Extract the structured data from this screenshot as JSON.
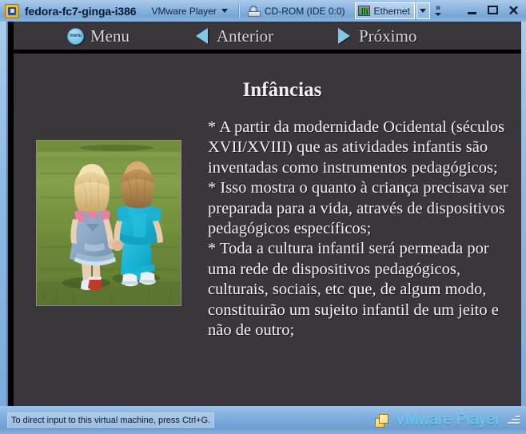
{
  "window": {
    "app_icon": "vmware-vm-icon",
    "title": "fedora-fc7-ginga-i386",
    "menu_label": "VMware Player",
    "cdrom_label": "CD-ROM (IDE 0:0)",
    "ethernet_label": "Ethernet",
    "overflow_label": "»",
    "minimize_label": "",
    "maximize_label": "",
    "close_label": "✕"
  },
  "app": {
    "menubar": {
      "menu": {
        "badge_text": "menu",
        "label": "Menu"
      },
      "previous": {
        "label": "Anterior"
      },
      "next": {
        "label": "Próximo"
      }
    },
    "slide": {
      "title": "Infâncias",
      "image_alt": "Duas crianças de mãos dadas caminhando na grama",
      "body": "* A partir da modernidade Ocidental (séculos XVII/XVIII) que as atividades infantis são inventadas como instrumentos pedagógicos;\n* Isso mostra o quanto à criança precisava ser preparada para a vida, através de dispositivos pedagógicos específicos;\n* Toda a cultura infantil será permeada por uma rede de dispositivos pedagógicos, culturais, sociais, etc que, de algum modo, constituirão um sujeito infantil de um jeito e não de outro;"
    }
  },
  "statusbar": {
    "message": "To direct input to this virtual machine, press Ctrl+G.",
    "brand": "VMware Player"
  },
  "colors": {
    "titlebar_blue": "#8cb6e2",
    "vm_background": "#3a363c",
    "accent_cyan": "#7ec8ea",
    "brand_cyan": "#5fd0fb",
    "slide_text": "#f4f2f0"
  }
}
